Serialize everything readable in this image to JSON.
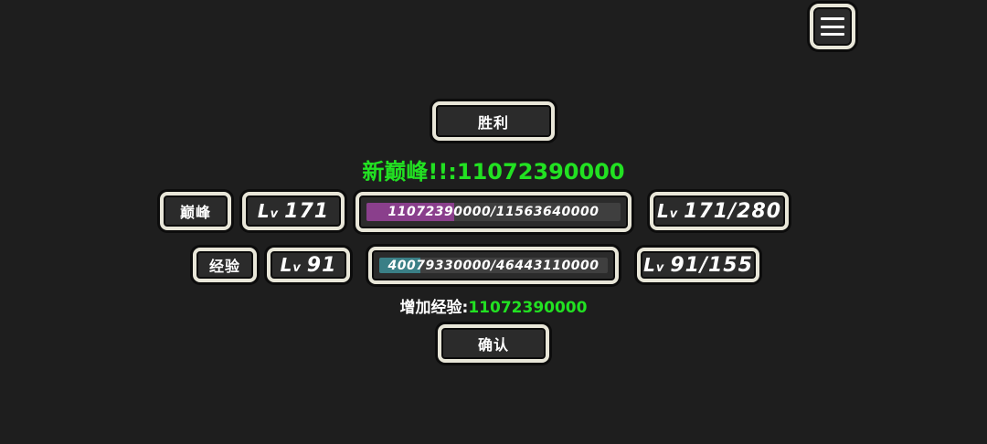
{
  "menu": {
    "icon": "hamburger-menu-icon"
  },
  "result": {
    "title": "胜利"
  },
  "new_peak": {
    "label": "新巅峰!!:",
    "value": "11072390000"
  },
  "peak_row": {
    "label": "巅峰",
    "level_prefix": "L",
    "level_sub": "v",
    "level": "171",
    "bar_text": "11072390000/11563640000",
    "bar_progress": 0.345,
    "bar_color": "#8a3f8c",
    "max_text": "171/280"
  },
  "exp_row": {
    "label": "经验",
    "level_prefix": "L",
    "level_sub": "v",
    "level": "91",
    "bar_text": "40079330000/46443110000",
    "bar_progress": 0.18,
    "bar_color": "#3a7f86",
    "max_text": "91/155"
  },
  "gain": {
    "label": "增加经验:",
    "value": "11072390000"
  },
  "confirm": {
    "label": "确认"
  },
  "colors": {
    "accent_green": "#22e122",
    "frame": "#e8e6d8",
    "background": "#1e1e1e"
  }
}
